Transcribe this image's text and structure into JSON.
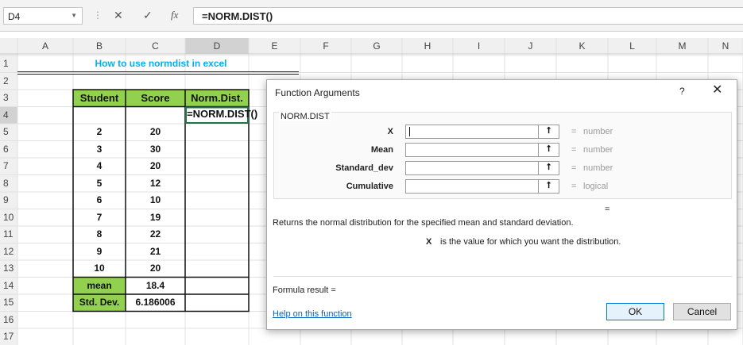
{
  "formula_bar": {
    "name_box": "D4",
    "formula": "=NORM.DIST()",
    "cancel_icon": "cancel-x-icon",
    "enter_icon": "checkmark-icon",
    "function_icon": "fx-icon"
  },
  "sheet": {
    "columns": [
      "A",
      "B",
      "C",
      "D",
      "E",
      "F",
      "G",
      "H",
      "I",
      "J",
      "K",
      "L",
      "M",
      "N"
    ],
    "rows": [
      "1",
      "2",
      "3",
      "4",
      "5",
      "6",
      "7",
      "8",
      "9",
      "10",
      "11",
      "12",
      "13",
      "14",
      "15",
      "16",
      "17"
    ],
    "title": "How to use normdist in excel",
    "headers": [
      "Student",
      "Score",
      "Norm.Dist."
    ],
    "active_cell_text": "=NORM.DIST()",
    "data_rows": [
      {
        "student": "2",
        "score": "20"
      },
      {
        "student": "3",
        "score": "30"
      },
      {
        "student": "4",
        "score": "20"
      },
      {
        "student": "5",
        "score": "12"
      },
      {
        "student": "6",
        "score": "10"
      },
      {
        "student": "7",
        "score": "19"
      },
      {
        "student": "8",
        "score": "22"
      },
      {
        "student": "9",
        "score": "21"
      },
      {
        "student": "10",
        "score": "20"
      }
    ],
    "summary": [
      {
        "label": "mean",
        "value": "18.4"
      },
      {
        "label": "Std. Dev.",
        "value": "6.186006"
      }
    ],
    "colors": {
      "header_fill": "#92d050",
      "title_text": "#00b0f0",
      "active_border": "#217346"
    }
  },
  "dialog": {
    "title": "Function Arguments",
    "help_glyph": "?",
    "close_glyph": "✕",
    "function_name": "NORM.DIST",
    "arguments": [
      {
        "label": "X",
        "value": "",
        "type": "number"
      },
      {
        "label": "Mean",
        "value": "",
        "type": "number"
      },
      {
        "label": "Standard_dev",
        "value": "",
        "type": "number"
      },
      {
        "label": "Cumulative",
        "value": "",
        "type": "logical"
      }
    ],
    "collapse_glyph": "⭡",
    "equals": "=",
    "result_equals": "=",
    "description": "Returns the normal distribution for the specified mean and standard deviation.",
    "arg_name": "X",
    "arg_description": "is the value for which you want the distribution.",
    "formula_result": "Formula result =",
    "help_link": "Help on this function",
    "ok_label": "OK",
    "cancel_label": "Cancel"
  }
}
